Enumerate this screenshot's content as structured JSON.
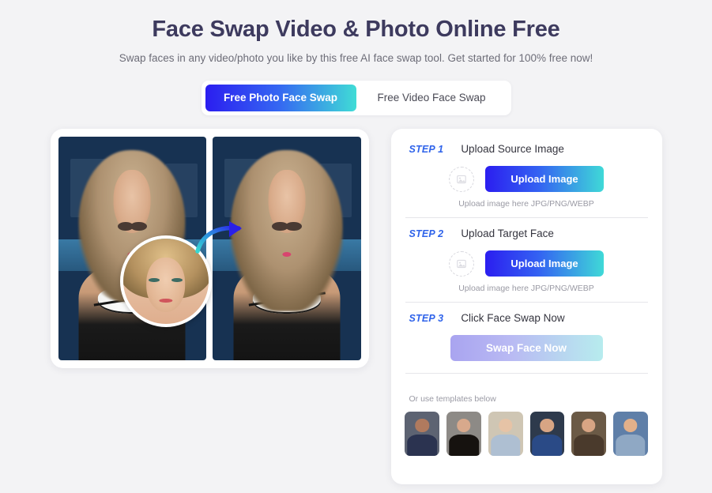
{
  "header": {
    "title": "Face Swap Video & Photo Online Free",
    "subtitle": "Swap faces in any video/photo you like by this free AI face swap tool. Get started for 100% free now!",
    "title_color": "#3d3a5e"
  },
  "tabs": {
    "items": [
      {
        "label": "Free Photo Face Swap",
        "active": true
      },
      {
        "label": "Free Video Face Swap",
        "active": false
      }
    ],
    "active_gradient_from": "#2b1ef0",
    "active_gradient_to": "#40dcd6"
  },
  "preview": {
    "name": "before-after-preview",
    "before_alt": "Original photo of woman by pool",
    "after_alt": "Face-swapped result photo",
    "face_bubble_alt": "Source face thumbnail",
    "arrow_icon": "curved-right-arrow-icon"
  },
  "steps": [
    {
      "number": "STEP 1",
      "title": "Upload Source Image",
      "drop_icon": "image-placeholder-icon",
      "button": "Upload Image",
      "hint": "Upload image here JPG/PNG/WEBP"
    },
    {
      "number": "STEP 2",
      "title": "Upload Target Face",
      "drop_icon": "image-placeholder-icon",
      "button": "Upload Image",
      "hint": "Upload image here JPG/PNG/WEBP"
    },
    {
      "number": "STEP 3",
      "title": "Click Face Swap Now",
      "button": "Swap Face Now",
      "button_disabled": true
    }
  ],
  "templates": {
    "label": "Or use templates below",
    "items": [
      {
        "alt": "woman in navy blazer template",
        "bg": "#5d6372",
        "skin": "#b07a5e",
        "cloth": "#2b3350"
      },
      {
        "alt": "woman with dark curly hair template",
        "bg": "#8d8a86",
        "skin": "#d8a98c",
        "cloth": "#16120f"
      },
      {
        "alt": "blonde woman in pale blue dress template",
        "bg": "#cfc6b4",
        "skin": "#e6c3a6",
        "cloth": "#aebfd2"
      },
      {
        "alt": "captain america template",
        "bg": "#2e3a4c",
        "skin": "#d8a584",
        "cloth": "#2a4a86"
      },
      {
        "alt": "red-haired warrior template",
        "bg": "#6b5a46",
        "skin": "#d8a584",
        "cloth": "#4a3a2c"
      },
      {
        "alt": "blond male footballer template",
        "bg": "#5f7fa8",
        "skin": "#e2b08a",
        "cloth": "#8fa8c4"
      }
    ]
  },
  "colors": {
    "page_bg": "#f3f3f5",
    "card_bg": "#ffffff",
    "accent_blue": "#2f63ea",
    "muted_text": "#9a9aa4"
  }
}
